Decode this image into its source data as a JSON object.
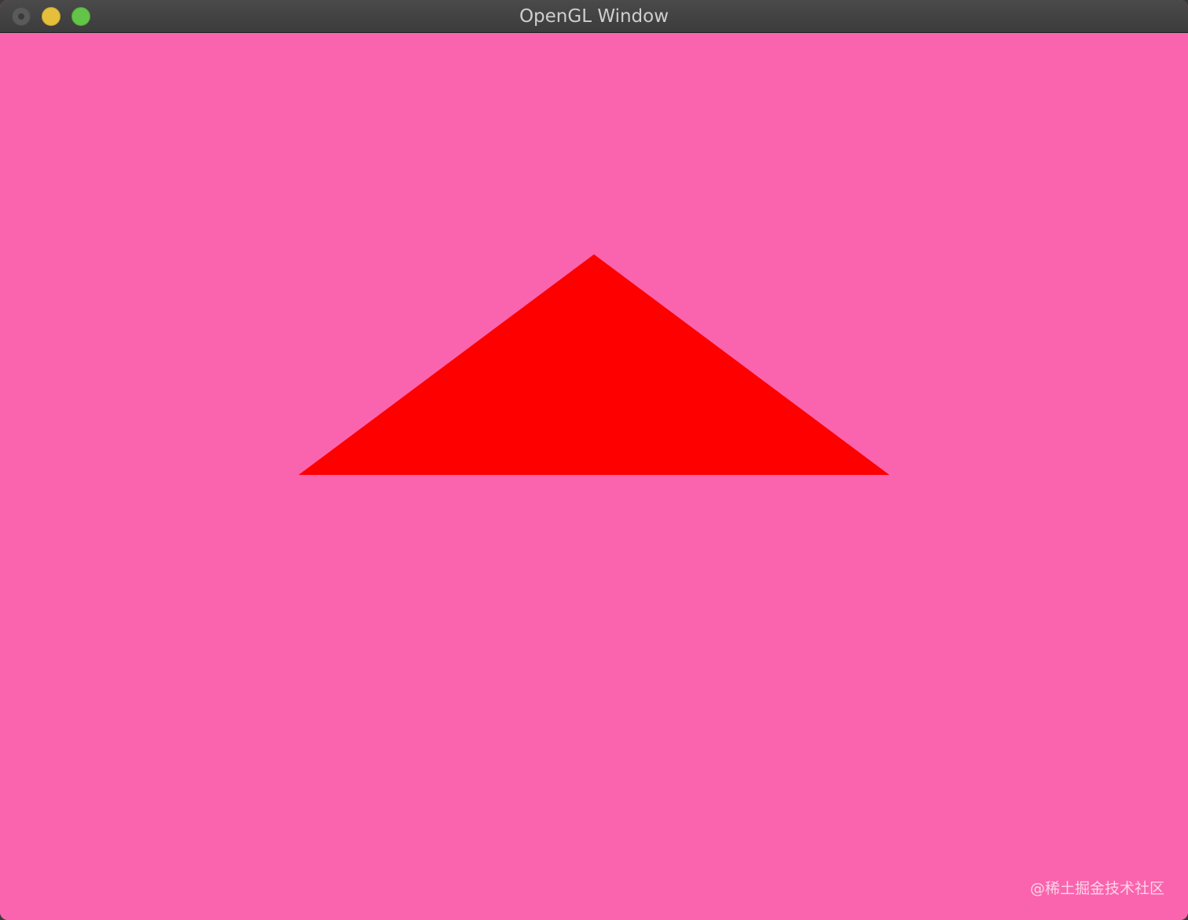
{
  "window": {
    "title": "OpenGL Window",
    "buttons": {
      "close": "close",
      "minimize": "minimize",
      "zoom": "zoom"
    }
  },
  "scene": {
    "clear_color": "#fa64ae",
    "triangle_color": "#ff0000"
  },
  "watermark": "@稀土掘金技术社区"
}
